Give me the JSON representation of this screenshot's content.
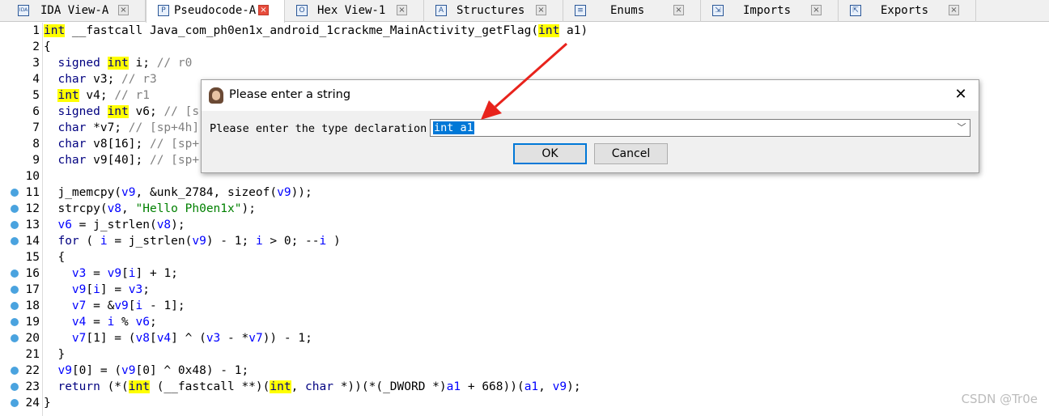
{
  "tabs": [
    {
      "label": "IDA View-A",
      "icon": "ida-view-icon",
      "glyph": "IDA",
      "active": false
    },
    {
      "label": "Pseudocode-A",
      "icon": "pseudocode-icon",
      "glyph": "P",
      "active": true
    },
    {
      "label": "Hex View-1",
      "icon": "hex-view-icon",
      "glyph": "O",
      "active": false
    },
    {
      "label": "Structures",
      "icon": "structures-icon",
      "glyph": "A",
      "active": false
    },
    {
      "label": "Enums",
      "icon": "enums-icon",
      "glyph": "≡",
      "active": false
    },
    {
      "label": "Imports",
      "icon": "imports-icon",
      "glyph": "⇲",
      "active": false
    },
    {
      "label": "Exports",
      "icon": "exports-icon",
      "glyph": "⇱",
      "active": false
    }
  ],
  "tab_close_glyph": "×",
  "code_lines": [
    {
      "num": "1",
      "bp": false,
      "tokens": [
        [
          "hl",
          "int"
        ],
        [
          "p",
          " __fastcall Java_com_ph0en1x_android_1crackme_MainActivity_getFlag("
        ],
        [
          "hl",
          "int"
        ],
        [
          "p",
          " a1)"
        ]
      ]
    },
    {
      "num": "2",
      "bp": false,
      "tokens": [
        [
          "p",
          "{"
        ]
      ]
    },
    {
      "num": "3",
      "bp": false,
      "tokens": [
        [
          "kw",
          "  signed "
        ],
        [
          "hl",
          "int"
        ],
        [
          "p",
          " i; "
        ],
        [
          "cm",
          "// r0"
        ]
      ]
    },
    {
      "num": "4",
      "bp": false,
      "tokens": [
        [
          "kw",
          "  char"
        ],
        [
          "p",
          " v3; "
        ],
        [
          "cm",
          "// r3"
        ]
      ]
    },
    {
      "num": "5",
      "bp": false,
      "tokens": [
        [
          "p",
          "  "
        ],
        [
          "hl",
          "int"
        ],
        [
          "p",
          " v4; "
        ],
        [
          "cm",
          "// r1"
        ]
      ]
    },
    {
      "num": "6",
      "bp": false,
      "tokens": [
        [
          "kw",
          "  signed "
        ],
        [
          "hl",
          "int"
        ],
        [
          "p",
          " v6; "
        ],
        [
          "cm",
          "// [s"
        ]
      ]
    },
    {
      "num": "7",
      "bp": false,
      "tokens": [
        [
          "kw",
          "  char"
        ],
        [
          "p",
          " *v7; "
        ],
        [
          "cm",
          "// [sp+4h]"
        ]
      ]
    },
    {
      "num": "8",
      "bp": false,
      "tokens": [
        [
          "kw",
          "  char"
        ],
        [
          "p",
          " v8[16]; "
        ],
        [
          "cm",
          "// [sp+"
        ]
      ]
    },
    {
      "num": "9",
      "bp": false,
      "tokens": [
        [
          "kw",
          "  char"
        ],
        [
          "p",
          " v9[40]; "
        ],
        [
          "cm",
          "// [sp+"
        ]
      ]
    },
    {
      "num": "10",
      "bp": false,
      "tokens": []
    },
    {
      "num": "11",
      "bp": true,
      "tokens": [
        [
          "p",
          "  j_memcpy("
        ],
        [
          "v",
          "v9"
        ],
        [
          "p",
          ", &unk_2784, sizeof("
        ],
        [
          "v",
          "v9"
        ],
        [
          "p",
          "));"
        ]
      ]
    },
    {
      "num": "12",
      "bp": true,
      "tokens": [
        [
          "p",
          "  strcpy("
        ],
        [
          "v",
          "v8"
        ],
        [
          "p",
          ", "
        ],
        [
          "str",
          "\"Hello Ph0en1x\""
        ],
        [
          "p",
          ");"
        ]
      ]
    },
    {
      "num": "13",
      "bp": true,
      "tokens": [
        [
          "p",
          "  "
        ],
        [
          "v",
          "v6"
        ],
        [
          "p",
          " = j_strlen("
        ],
        [
          "v",
          "v8"
        ],
        [
          "p",
          ");"
        ]
      ]
    },
    {
      "num": "14",
      "bp": true,
      "tokens": [
        [
          "kw",
          "  for"
        ],
        [
          "p",
          " ( "
        ],
        [
          "v",
          "i"
        ],
        [
          "p",
          " = j_strlen("
        ],
        [
          "v",
          "v9"
        ],
        [
          "p",
          ") - 1; "
        ],
        [
          "v",
          "i"
        ],
        [
          "p",
          " > 0; --"
        ],
        [
          "v",
          "i"
        ],
        [
          "p",
          " )"
        ]
      ]
    },
    {
      "num": "15",
      "bp": false,
      "tokens": [
        [
          "p",
          "  {"
        ]
      ]
    },
    {
      "num": "16",
      "bp": true,
      "tokens": [
        [
          "p",
          "    "
        ],
        [
          "v",
          "v3"
        ],
        [
          "p",
          " = "
        ],
        [
          "v",
          "v9"
        ],
        [
          "p",
          "["
        ],
        [
          "v",
          "i"
        ],
        [
          "p",
          "] + 1;"
        ]
      ]
    },
    {
      "num": "17",
      "bp": true,
      "tokens": [
        [
          "p",
          "    "
        ],
        [
          "v",
          "v9"
        ],
        [
          "p",
          "["
        ],
        [
          "v",
          "i"
        ],
        [
          "p",
          "] = "
        ],
        [
          "v",
          "v3"
        ],
        [
          "p",
          ";"
        ]
      ]
    },
    {
      "num": "18",
      "bp": true,
      "tokens": [
        [
          "p",
          "    "
        ],
        [
          "v",
          "v7"
        ],
        [
          "p",
          " = &"
        ],
        [
          "v",
          "v9"
        ],
        [
          "p",
          "["
        ],
        [
          "v",
          "i"
        ],
        [
          "p",
          " - 1];"
        ]
      ]
    },
    {
      "num": "19",
      "bp": true,
      "tokens": [
        [
          "p",
          "    "
        ],
        [
          "v",
          "v4"
        ],
        [
          "p",
          " = "
        ],
        [
          "v",
          "i"
        ],
        [
          "p",
          " % "
        ],
        [
          "v",
          "v6"
        ],
        [
          "p",
          ";"
        ]
      ]
    },
    {
      "num": "20",
      "bp": true,
      "tokens": [
        [
          "p",
          "    "
        ],
        [
          "v",
          "v7"
        ],
        [
          "p",
          "[1] = ("
        ],
        [
          "v",
          "v8"
        ],
        [
          "p",
          "["
        ],
        [
          "v",
          "v4"
        ],
        [
          "p",
          "] ^ ("
        ],
        [
          "v",
          "v3"
        ],
        [
          "p",
          " - *"
        ],
        [
          "v",
          "v7"
        ],
        [
          "p",
          ")) - 1;"
        ]
      ]
    },
    {
      "num": "21",
      "bp": false,
      "tokens": [
        [
          "p",
          "  }"
        ]
      ]
    },
    {
      "num": "22",
      "bp": true,
      "tokens": [
        [
          "p",
          "  "
        ],
        [
          "v",
          "v9"
        ],
        [
          "p",
          "[0] = ("
        ],
        [
          "v",
          "v9"
        ],
        [
          "p",
          "[0] ^ 0x48) - 1;"
        ]
      ]
    },
    {
      "num": "23",
      "bp": true,
      "tokens": [
        [
          "kw",
          "  return"
        ],
        [
          "p",
          " (*("
        ],
        [
          "hl",
          "int"
        ],
        [
          "p",
          " (__fastcall **)("
        ],
        [
          "hl",
          "int"
        ],
        [
          "p",
          ", "
        ],
        [
          "kw",
          "char"
        ],
        [
          "p",
          " *))(*(_DWORD *)"
        ],
        [
          "v",
          "a1"
        ],
        [
          "p",
          " + 668))("
        ],
        [
          "v",
          "a1"
        ],
        [
          "p",
          ", "
        ],
        [
          "v",
          "v9"
        ],
        [
          "p",
          ");"
        ]
      ]
    },
    {
      "num": "24",
      "bp": true,
      "tokens": [
        [
          "p",
          "}"
        ]
      ]
    }
  ],
  "dialog": {
    "title": "Please enter a string",
    "close_glyph": "✕",
    "label": "Please enter the type declaration",
    "input_value": "int a1",
    "dropdown_glyph": "﹀",
    "ok_label": "OK",
    "cancel_label": "Cancel"
  },
  "watermark": "CSDN @Tr0e",
  "colors": {
    "highlight": "#ffff00",
    "keyword": "#000080",
    "variable": "#0000ff",
    "comment": "#808080",
    "string": "#008000",
    "arrow": "#e8231c",
    "selection": "#0078d7"
  }
}
